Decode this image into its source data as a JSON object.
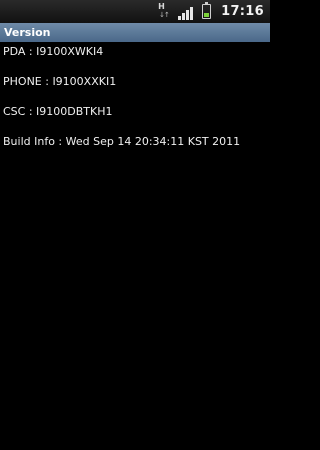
{
  "status_bar": {
    "network_indicator": "H",
    "network_arrows": "↓↑",
    "clock": "17:16",
    "signal_icon": "signal-bars",
    "battery_icon": "battery-low",
    "battery_level": 0.3
  },
  "title_bar": {
    "title": "Version"
  },
  "version_info": {
    "pda": "PDA : I9100XWKI4",
    "phone": "PHONE : I9100XXKI1",
    "csc": "CSC : I9100DBTKH1",
    "build_info": "Build Info : Wed Sep 14 20:34:11 KST 2011"
  },
  "colors": {
    "background": "#000000",
    "title_bar": "#5a7898",
    "text": "#f0f0f0",
    "battery_fill": "#7dd33a"
  }
}
